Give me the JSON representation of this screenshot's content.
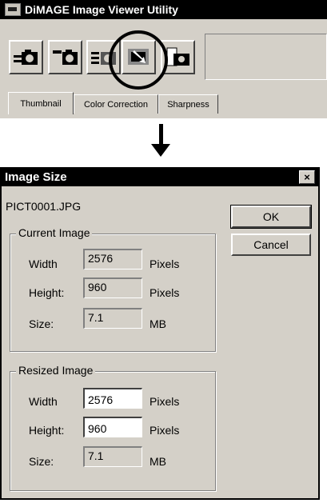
{
  "app": {
    "title": "DiMAGE Image Viewer Utility",
    "tabs": [
      {
        "label": "Thumbnail"
      },
      {
        "label": "Color Correction"
      },
      {
        "label": "Sharpness"
      }
    ],
    "toolbar_icons": [
      "camera-send-icon",
      "camera-receive-icon",
      "camera-delete-icon",
      "image-resize-icon",
      "camera-settings-icon"
    ]
  },
  "dialog": {
    "title": "Image Size",
    "close_label": "×",
    "filename": "PICT0001.JPG",
    "ok_label": "OK",
    "cancel_label": "Cancel",
    "current": {
      "legend": "Current Image",
      "width_label": "Width",
      "width_value": "2576",
      "width_unit": "Pixels",
      "height_label": "Height:",
      "height_value": "960",
      "height_unit": "Pixels",
      "size_label": "Size:",
      "size_value": "7.1",
      "size_unit": "MB"
    },
    "resized": {
      "legend": "Resized Image",
      "width_label": "Width",
      "width_value": "2576",
      "width_unit": "Pixels",
      "height_label": "Height:",
      "height_value": "960",
      "height_unit": "Pixels",
      "size_label": "Size:",
      "size_value": "7.1",
      "size_unit": "MB"
    }
  }
}
